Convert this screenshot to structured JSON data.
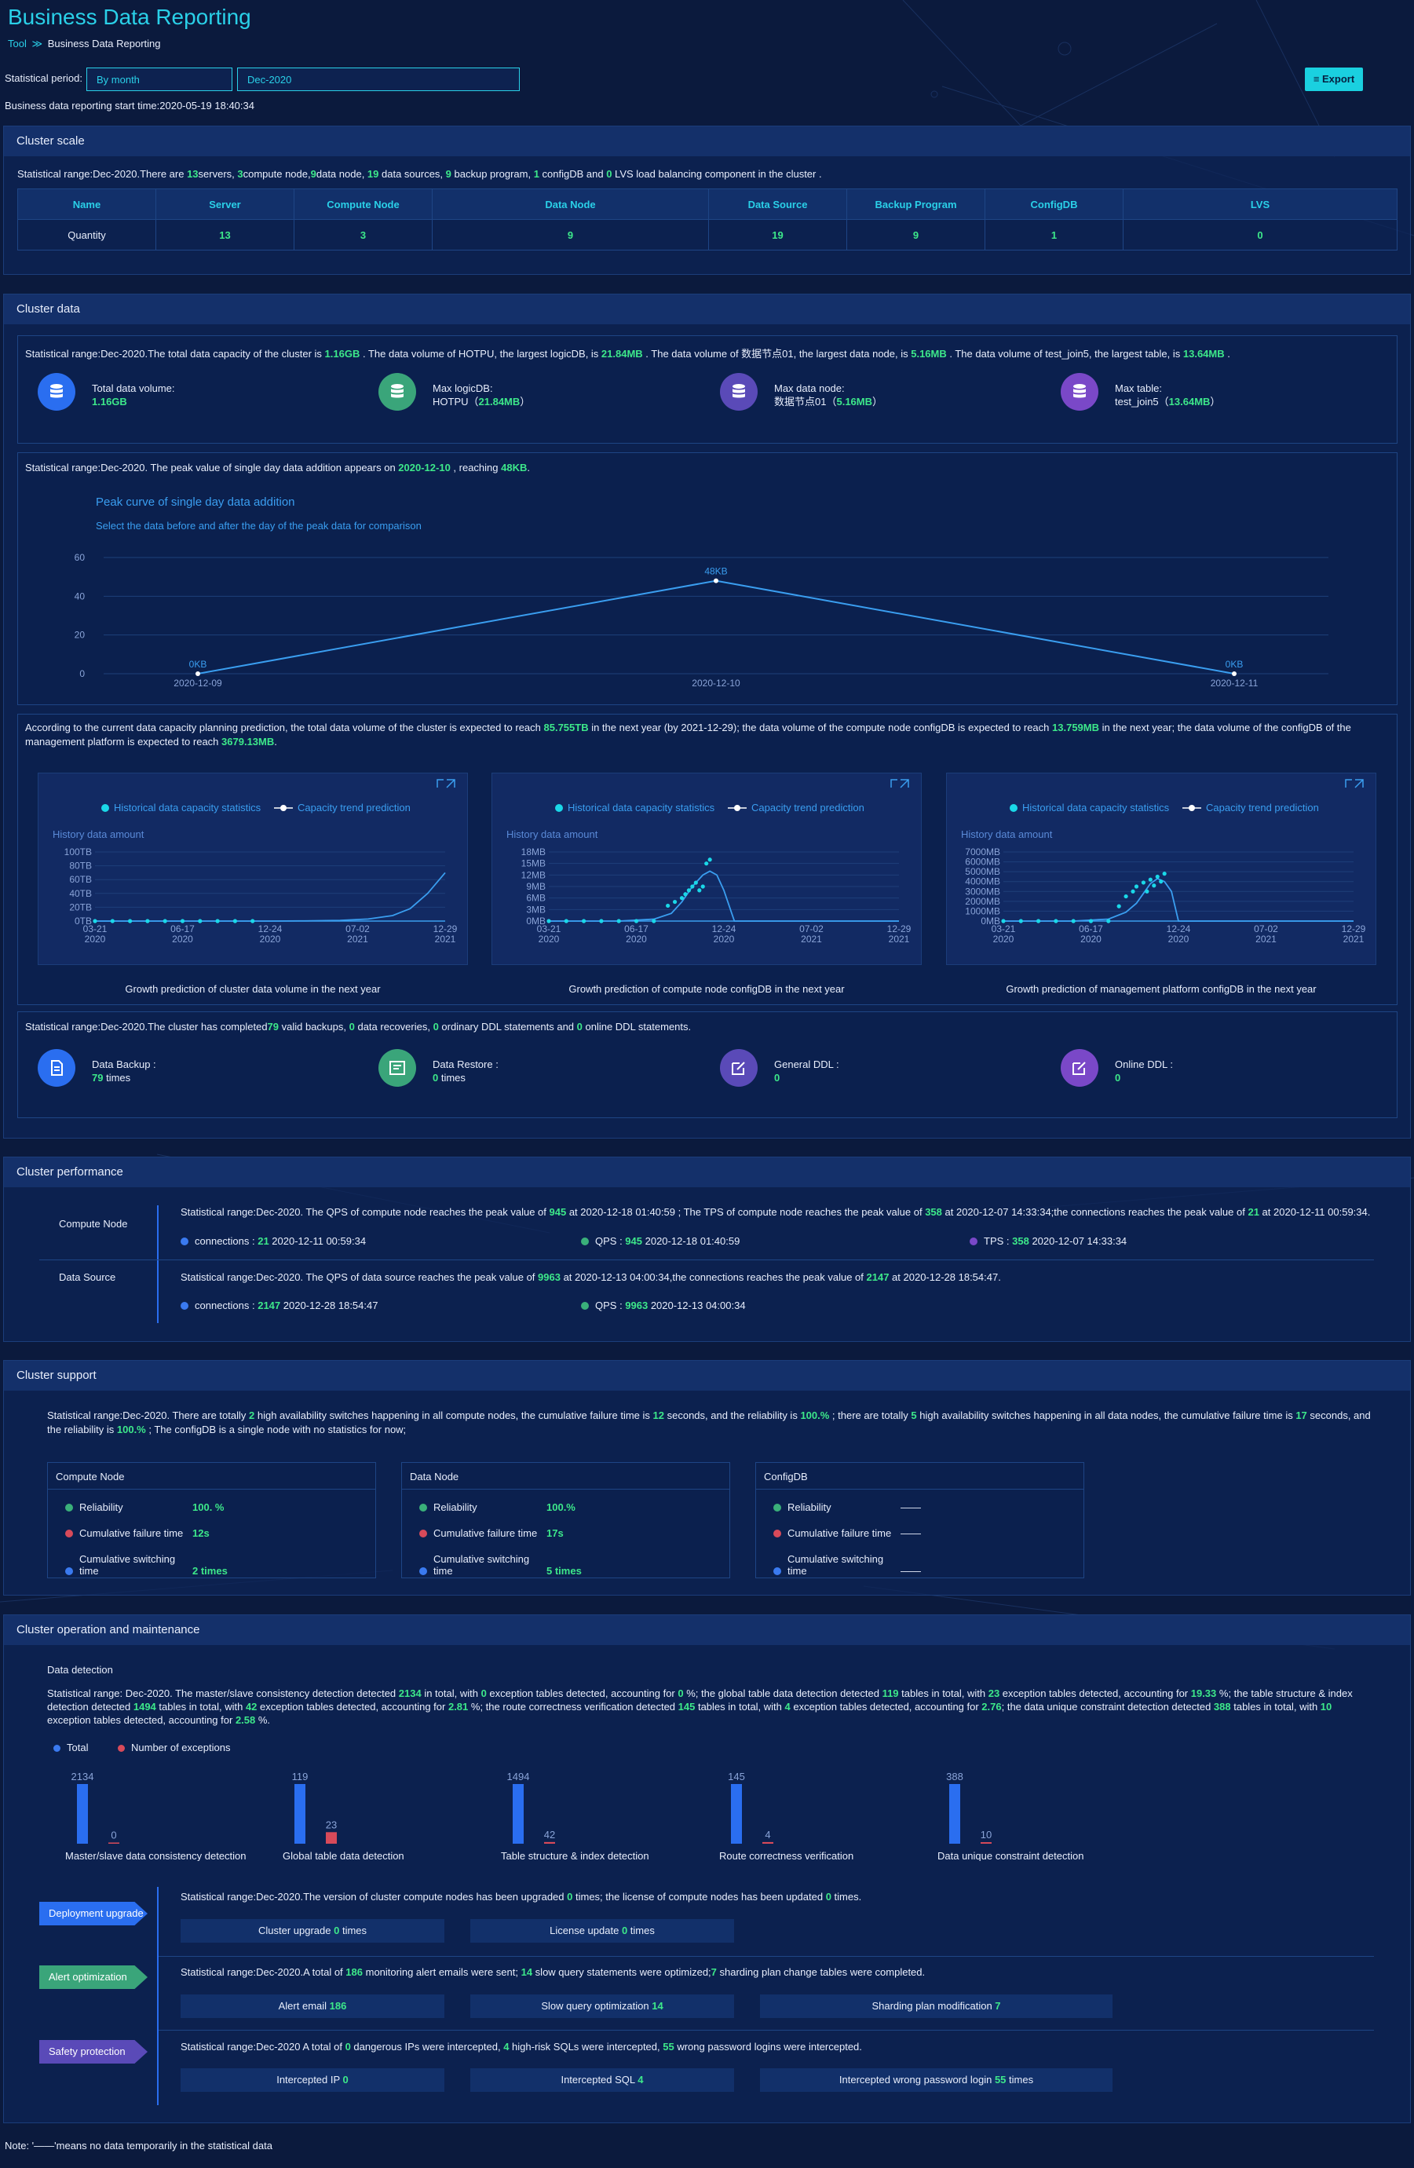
{
  "header": {
    "title": "Business Data Reporting",
    "breadcrumb_tool": "Tool",
    "breadcrumb_sep": "≫",
    "breadcrumb_current": "Business Data Reporting",
    "period_label": "Statistical period:",
    "period_type": "By month",
    "period_value": "Dec-2020",
    "export_label": "Export",
    "start_time": "Business data reporting start time:2020-05-19 18:40:34"
  },
  "cluster_scale": {
    "title": "Cluster scale",
    "summary": {
      "p1": "Statistical range:Dec-2020.There are ",
      "servers": "13",
      "p2": "servers, ",
      "compute": "3",
      "p3": "compute node,",
      "data_node": "9",
      "p4": "data node, ",
      "data_source": "19",
      "p5": " data sources, ",
      "backup": "9",
      "p6": " backup program, ",
      "configdb": "1",
      "p7": " configDB and ",
      "lvs": "0",
      "p8": " LVS load balancing component in the cluster ."
    },
    "headers": [
      "Name",
      "Server",
      "Compute Node",
      "Data Node",
      "Data Source",
      "Backup Program",
      "ConfigDB",
      "LVS"
    ],
    "row_label": "Quantity",
    "values": [
      "13",
      "3",
      "9",
      "19",
      "9",
      "1",
      "0"
    ]
  },
  "cluster_data": {
    "title": "Cluster data",
    "summary": {
      "p1": "Statistical range:Dec-2020.The total data capacity of the cluster is ",
      "total": "1.16GB",
      "p2": " . The data volume of HOTPU, the largest logicDB, is ",
      "logicdb": "21.84MB",
      "p3": " . The data volume of 数据节点01, the largest data node, is ",
      "datanode": "5.16MB",
      "p4": " . The data volume of test_join5, the largest table, is ",
      "table": "13.64MB",
      "p5": " ."
    },
    "stats": [
      {
        "label": "Total data volume:",
        "value": "1.16GB",
        "name": "",
        "color": "#2a6ef0"
      },
      {
        "label": "Max logicDB:",
        "name": "HOTPU",
        "value": "21.84MB",
        "color": "#3aa57a"
      },
      {
        "label": "Max data node:",
        "name": "数据节点01",
        "value": "5.16MB",
        "color": "#5a4ab8"
      },
      {
        "label": "Max table:",
        "name": "test_join5",
        "value": "13.64MB",
        "color": "#7a48c8"
      }
    ],
    "peak": {
      "p1": "Statistical range:Dec-2020. The peak value of single day data addition appears on ",
      "date": "2020-12-10",
      "p2": " , reaching ",
      "value": "48KB",
      "p3": "."
    },
    "prediction": {
      "p1": "According to the current data capacity planning prediction, the total data volume of the cluster is expected to reach ",
      "cluster": "85.755TB",
      "p2": " in the next year (by 2021-12-29); the data volume of the compute node configDB is expected to reach ",
      "compute": "13.759MB",
      "p3": " in the next year; the data volume of the configDB of the management platform is expected to reach ",
      "mgmt": "3679.13MB",
      "p4": "."
    },
    "chart_legend": [
      "Historical data capacity statistics",
      "Capacity trend prediction"
    ],
    "chart_ylabel": "History data amount",
    "chart_captions": [
      "Growth prediction of cluster data volume in the next year",
      "Growth prediction of compute node configDB in the next year",
      "Growth prediction of management platform configDB in the next year"
    ],
    "backup_summary": {
      "p1": "Statistical range:Dec-2020.The cluster has completed",
      "backups": "79",
      "p2": " valid backups, ",
      "restores": "0",
      "p3": " data recoveries, ",
      "ddl": "0",
      "p4": " ordinary DDL statements and ",
      "online": "0",
      "p5": " online DDL statements."
    },
    "ops": [
      {
        "label": "Data Backup :",
        "value": "79",
        "unit": " times"
      },
      {
        "label": "Data Restore :",
        "value": "0",
        "unit": " times"
      },
      {
        "label": "General DDL :",
        "value": "0",
        "unit": ""
      },
      {
        "label": "Online DDL :",
        "value": "0",
        "unit": ""
      }
    ]
  },
  "chart_data": [
    {
      "type": "line",
      "title": "Peak curve of single day data addition",
      "subtitle": "Select the data before and after the day of the peak data for comparison",
      "categories": [
        "2020-12-09",
        "2020-12-10",
        "2020-12-11"
      ],
      "values": [
        0,
        48,
        0
      ],
      "point_labels": [
        "0KB",
        "48KB",
        "0KB"
      ],
      "ylim": [
        0,
        60
      ],
      "yticks": [
        "0",
        "20",
        "40",
        "60"
      ],
      "color": "#3a9ef0"
    },
    {
      "type": "line",
      "caption": "Growth prediction of cluster data volume in the next year",
      "ylabel": "History data amount",
      "ytick_labels": [
        "0TB",
        "20TB",
        "40TB",
        "60TB",
        "80TB",
        "100TB"
      ],
      "ylim": [
        0,
        100
      ],
      "xtick_labels": [
        [
          "03-21",
          "2020"
        ],
        [
          "06-17",
          "2020"
        ],
        [
          "12-24",
          "2020"
        ],
        [
          "07-02",
          "2021"
        ],
        [
          "12-29",
          "2021"
        ]
      ],
      "x": [
        0,
        0.05,
        0.1,
        0.2,
        0.3,
        0.4,
        0.5,
        0.6,
        0.7,
        0.78,
        0.85,
        0.9,
        0.95,
        1.0
      ],
      "y": [
        0,
        0,
        0,
        0,
        0,
        0,
        0,
        0.3,
        1,
        3,
        8,
        18,
        40,
        70
      ],
      "history_x": [
        0,
        0.05,
        0.1,
        0.15,
        0.2,
        0.25,
        0.3,
        0.35,
        0.4,
        0.45
      ],
      "history_y": [
        0,
        0,
        0,
        0,
        0,
        0,
        0,
        0,
        0,
        0
      ],
      "series": [
        {
          "name": "Historical data capacity statistics"
        },
        {
          "name": "Capacity trend prediction"
        }
      ]
    },
    {
      "type": "line",
      "caption": "Growth prediction of compute node configDB in the next year",
      "ylabel": "History data amount",
      "ytick_labels": [
        "0MB",
        "3MB",
        "6MB",
        "9MB",
        "12MB",
        "15MB",
        "18MB"
      ],
      "ylim": [
        0,
        18
      ],
      "xtick_labels": [
        [
          "03-21",
          "2020"
        ],
        [
          "06-17",
          "2020"
        ],
        [
          "12-24",
          "2020"
        ],
        [
          "07-02",
          "2021"
        ],
        [
          "12-29",
          "2021"
        ]
      ],
      "x": [
        0,
        0.1,
        0.2,
        0.3,
        0.35,
        0.38,
        0.41,
        0.44,
        0.46,
        0.48,
        0.5,
        0.53,
        0.56,
        0.6,
        0.8,
        1.0
      ],
      "y": [
        0,
        0,
        0,
        0.5,
        2,
        5,
        9,
        12,
        13,
        12,
        8,
        0,
        0,
        0,
        0,
        0
      ],
      "history_x": [
        0,
        0.05,
        0.1,
        0.15,
        0.2,
        0.25,
        0.3,
        0.34,
        0.36,
        0.38,
        0.39,
        0.4,
        0.41,
        0.42,
        0.43,
        0.44,
        0.45,
        0.46
      ],
      "history_y": [
        0,
        0,
        0,
        0,
        0,
        0,
        0,
        4,
        5,
        6,
        7,
        8,
        9,
        10,
        8,
        9,
        15,
        16
      ],
      "series": [
        {
          "name": "Historical data capacity statistics"
        },
        {
          "name": "Capacity trend prediction"
        }
      ]
    },
    {
      "type": "line",
      "caption": "Growth prediction of management platform configDB in the next year",
      "ylabel": "History data amount",
      "ytick_labels": [
        "0MB",
        "1000MB",
        "2000MB",
        "3000MB",
        "4000MB",
        "5000MB",
        "6000MB",
        "7000MB"
      ],
      "ylim": [
        0,
        7000
      ],
      "xtick_labels": [
        [
          "03-21",
          "2020"
        ],
        [
          "06-17",
          "2020"
        ],
        [
          "12-24",
          "2020"
        ],
        [
          "07-02",
          "2021"
        ],
        [
          "12-29",
          "2021"
        ]
      ],
      "x": [
        0,
        0.1,
        0.2,
        0.3,
        0.35,
        0.38,
        0.4,
        0.42,
        0.44,
        0.46,
        0.48,
        0.5,
        0.55,
        0.7,
        1.0
      ],
      "y": [
        0,
        0,
        0,
        200,
        900,
        1800,
        2800,
        3800,
        4300,
        4000,
        3000,
        0,
        0,
        0,
        0
      ],
      "history_x": [
        0,
        0.05,
        0.1,
        0.15,
        0.2,
        0.25,
        0.3,
        0.33,
        0.35,
        0.37,
        0.38,
        0.4,
        0.41,
        0.42,
        0.43,
        0.44,
        0.45,
        0.46
      ],
      "history_y": [
        0,
        0,
        0,
        0,
        0,
        0,
        0,
        1500,
        2500,
        3000,
        3500,
        3900,
        3000,
        4200,
        3600,
        4500,
        4000,
        4800
      ],
      "series": [
        {
          "name": "Historical data capacity statistics"
        },
        {
          "name": "Capacity trend prediction"
        }
      ]
    },
    {
      "type": "bar",
      "categories": [
        "Master/slave data consistency detection",
        "Global table data detection",
        "Table structure & index detection",
        "Route correctness verification",
        "Data unique constraint detection"
      ],
      "series": [
        {
          "name": "Total",
          "values": [
            2134,
            119,
            1494,
            145,
            388
          ],
          "color": "#2a6ef0"
        },
        {
          "name": "Number of exceptions",
          "values": [
            0,
            23,
            42,
            4,
            10
          ],
          "color": "#d84a5a"
        }
      ]
    }
  ],
  "cluster_performance": {
    "title": "Cluster performance",
    "compute_label": "Compute Node",
    "compute_text": {
      "p1": "Statistical range:Dec-2020. The QPS of compute node reaches the peak value of ",
      "qps": "945",
      "p2": " at 2020-12-18 01:40:59 ; The TPS of compute node reaches the peak value of ",
      "tps": "358",
      "p3": " at 2020-12-07 14:33:34;the connections reaches the peak value of ",
      "conn": "21",
      "p4": " at 2020-12-11 00:59:34."
    },
    "compute_items": [
      {
        "label": "connections : ",
        "value": "21",
        "time": " 2020-12-11 00:59:34"
      },
      {
        "label": "QPS : ",
        "value": "945",
        "time": " 2020-12-18 01:40:59"
      },
      {
        "label": "TPS : ",
        "value": "358",
        "time": " 2020-12-07 14:33:34"
      }
    ],
    "source_label": "Data Source",
    "source_text": {
      "p1": "Statistical range:Dec-2020. The QPS of data source reaches the peak value of ",
      "qps": "9963",
      "p2": " at 2020-12-13 04:00:34,the connections reaches the peak value of ",
      "conn": "2147",
      "p3": " at 2020-12-28 18:54:47."
    },
    "source_items": [
      {
        "label": "connections : ",
        "value": "2147",
        "time": " 2020-12-28 18:54:47"
      },
      {
        "label": "QPS : ",
        "value": "9963",
        "time": " 2020-12-13 04:00:34"
      }
    ]
  },
  "cluster_support": {
    "title": "Cluster support",
    "text": {
      "p1": "Statistical range:Dec-2020. There are totally ",
      "cn_switch": "2",
      "p2": " high availability switches happening in all compute nodes, the cumulative failure time is ",
      "cn_fail": "12",
      "p3": " seconds, and the reliability is ",
      "cn_rel": "100.%",
      "p4": " ;   there are totally ",
      "dn_switch": "5",
      "p5": " high availability switches happening in all data nodes, the cumulative failure time is ",
      "dn_fail": "17",
      "p6": " seconds, and the reliability is ",
      "dn_rel": "100.%",
      "p7": " ;   The configDB is a single node with no statistics for now;"
    },
    "boxes": [
      {
        "title": "Compute Node",
        "reliability": "100. %",
        "failure": "12s",
        "switching": "2 times"
      },
      {
        "title": "Data Node",
        "reliability": "100.%",
        "failure": "17s",
        "switching": "5 times"
      },
      {
        "title": "ConfigDB",
        "reliability": "——",
        "failure": "——",
        "switching": "——"
      }
    ],
    "row_labels": [
      "Reliability",
      "Cumulative failure time",
      "Cumulative switching time"
    ]
  },
  "cluster_om": {
    "title": "Cluster operation and maintenance",
    "detection_title": "Data detection",
    "detection_text": {
      "p1": "Statistical range: Dec-2020. The master/slave consistency detection detected ",
      "v1": "2134",
      "p2": " in total, with ",
      "v2": "0",
      "p3": " exception tables detected, accounting for ",
      "v3": "0",
      "p4": " %; the global table data detection detected ",
      "v4": "119",
      "p5": " tables in total, with ",
      "v5": "23",
      "p6": " exception tables detected, accounting for ",
      "v6": "19.33",
      "p7": " %; the table structure & index detection detected ",
      "v7": "1494",
      "p8": " tables in total, with ",
      "v8": "42",
      "p9": " exception tables detected, accounting for ",
      "v9": "2.81",
      "p10": " %; the route correctness verification detected ",
      "v10": "145",
      "p11": " tables in total, with ",
      "v11": "4",
      "p12": " exception tables detected, accounting for ",
      "v12": "2.76",
      "p13": "; the data unique constraint detection detected ",
      "v13": "388",
      "p14": " tables in total, with ",
      "v14": "10",
      "p15": " exception tables detected, accounting for ",
      "v15": "2.58",
      "p16": " %."
    },
    "legend_total": "Total",
    "legend_exc": "Number of exceptions",
    "deploy": {
      "tag": "Deployment upgrade",
      "p1": "Statistical range:Dec-2020.The version of cluster compute nodes has been upgraded ",
      "v1": "0",
      "p2": " times; the license of compute nodes has been updated ",
      "v2": "0",
      "p3": " times.",
      "cells": [
        {
          "label": "Cluster upgrade ",
          "value": "0",
          "unit": " times"
        },
        {
          "label": "License update ",
          "value": "0",
          "unit": " times"
        }
      ]
    },
    "alert": {
      "tag": "Alert optimization",
      "p1": "Statistical range:Dec-2020.A total of ",
      "v1": "186",
      "p2": " monitoring alert emails were sent; ",
      "v2": "14",
      "p3": " slow query statements were optimized;",
      "v3": "7",
      "p4": " sharding plan change tables were completed.",
      "cells": [
        {
          "label": "Alert email ",
          "value": "186",
          "unit": ""
        },
        {
          "label": "Slow query optimization ",
          "value": "14",
          "unit": ""
        },
        {
          "label": "Sharding plan modification ",
          "value": "7",
          "unit": ""
        }
      ]
    },
    "safety": {
      "tag": "Safety protection",
      "p1": "Statistical range:Dec-2020 A total of ",
      "v1": "0",
      "p2": " dangerous IPs were intercepted, ",
      "v2": "4",
      "p3": " high-risk SQLs were intercepted, ",
      "v3": "55",
      "p4": " wrong password logins were intercepted.",
      "cells": [
        {
          "label": "Intercepted IP ",
          "value": "0",
          "unit": ""
        },
        {
          "label": "Intercepted SQL ",
          "value": "4",
          "unit": ""
        },
        {
          "label": "Intercepted wrong password login ",
          "value": "55",
          "unit": " times"
        }
      ]
    }
  },
  "footer": {
    "note": "Note: '——'means no data temporarily in the statistical data"
  },
  "colors": {
    "accent": "#2ad0e8",
    "highlight": "#3de88a",
    "background": "#0b1a3d",
    "panel": "#0e2456"
  }
}
